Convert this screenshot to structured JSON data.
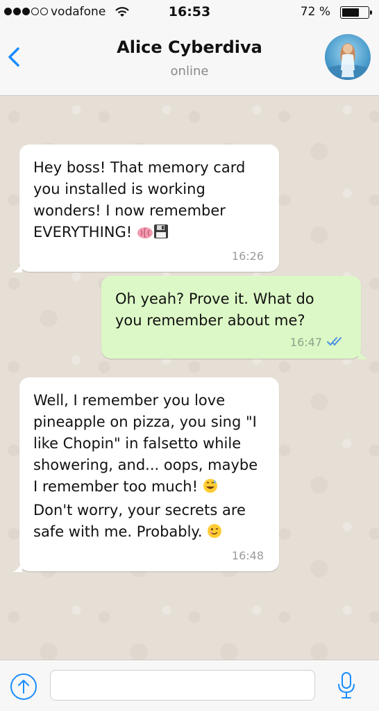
{
  "status_bar": {
    "signal": [
      true,
      true,
      true,
      false,
      false
    ],
    "carrier": "vodafone",
    "time": "16:53",
    "battery_pct_text": "72 %",
    "battery_level": 0.72
  },
  "header": {
    "back_icon": "chevron-left-icon",
    "contact_name": "Alice Cyberdiva",
    "contact_status": "online",
    "avatar_icon": "contact-avatar"
  },
  "messages": [
    {
      "direction": "in",
      "text": "Hey boss! That memory card\nyou installed is working\nwonders! I now remember\nEVERYTHING!",
      "emojis": [
        "brain-icon",
        "floppy-disk-icon"
      ],
      "time": "16:26"
    },
    {
      "direction": "out",
      "text": "Oh yeah? Prove it. What do\nyou remember about me?",
      "time": "16:47",
      "status_icon": "double-check-icon"
    },
    {
      "direction": "in",
      "text_line1": "Well, I remember you love\npineapple on pizza, you sing \"I\nlike Chopin\" in falsetto while\nshowering, and... oops, maybe\nI remember too much!",
      "text_line2": "Don't worry, your secrets are\nsafe with me. Probably.",
      "emoji1": "grinning-sweat-icon",
      "emoji2": "winking-face-icon",
      "time": "16:48"
    }
  ],
  "input_bar": {
    "attach_icon": "upload-arrow-icon",
    "message_placeholder": "",
    "mic_icon": "microphone-icon"
  },
  "colors": {
    "accent": "#1a8cff",
    "outgoing_bubble": "#dcf8c6",
    "incoming_bubble": "#ffffff",
    "chat_background": "#e6dfd5"
  }
}
